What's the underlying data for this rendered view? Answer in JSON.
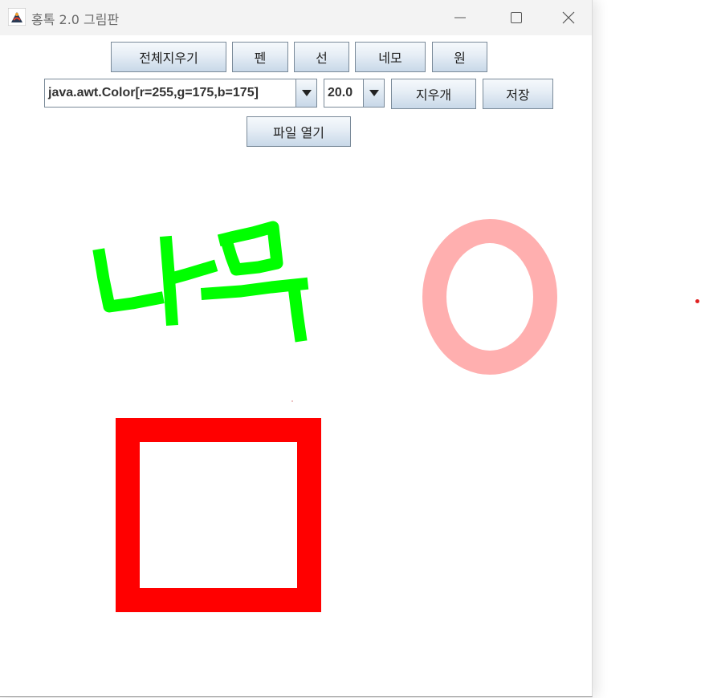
{
  "window": {
    "title": "홍톡 2.0 그림판"
  },
  "toolbar": {
    "row1": [
      {
        "label": "전체지우기"
      },
      {
        "label": "펜"
      },
      {
        "label": "선"
      },
      {
        "label": "네모"
      },
      {
        "label": "원"
      }
    ],
    "color_select": {
      "selected": "java.awt.Color[r=255,g=175,b=175]"
    },
    "size_select": {
      "selected": "20.0"
    },
    "eraser_label": "지우개",
    "save_label": "저장",
    "open_file_label": "파일 열기"
  },
  "canvas": {
    "pen_color": "#00ff00",
    "rect_color": "#ff0000",
    "circle_color": "#ffafaf"
  },
  "icons": [
    "java-app-icon",
    "minimize-icon",
    "maximize-icon",
    "close-icon",
    "chevron-down-icon"
  ]
}
